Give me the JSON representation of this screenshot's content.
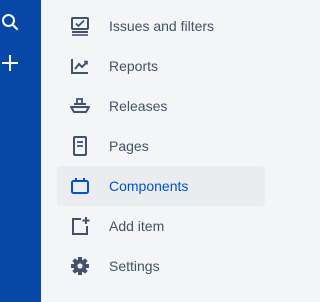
{
  "global_nav": {
    "background": "#0747a6",
    "icons": [
      "search-icon",
      "create-icon"
    ]
  },
  "project_nav": {
    "selected_color": "#0052cc",
    "text_color": "#42526e",
    "items": [
      {
        "label": "Issues and filters",
        "icon": "issues-icon"
      },
      {
        "label": "Reports",
        "icon": "reports-icon"
      },
      {
        "label": "Releases",
        "icon": "releases-icon"
      },
      {
        "label": "Pages",
        "icon": "pages-icon"
      },
      {
        "label": "Components",
        "icon": "components-icon",
        "selected": true
      },
      {
        "label": "Add item",
        "icon": "add-item-icon"
      },
      {
        "label": "Settings",
        "icon": "settings-icon"
      }
    ]
  }
}
